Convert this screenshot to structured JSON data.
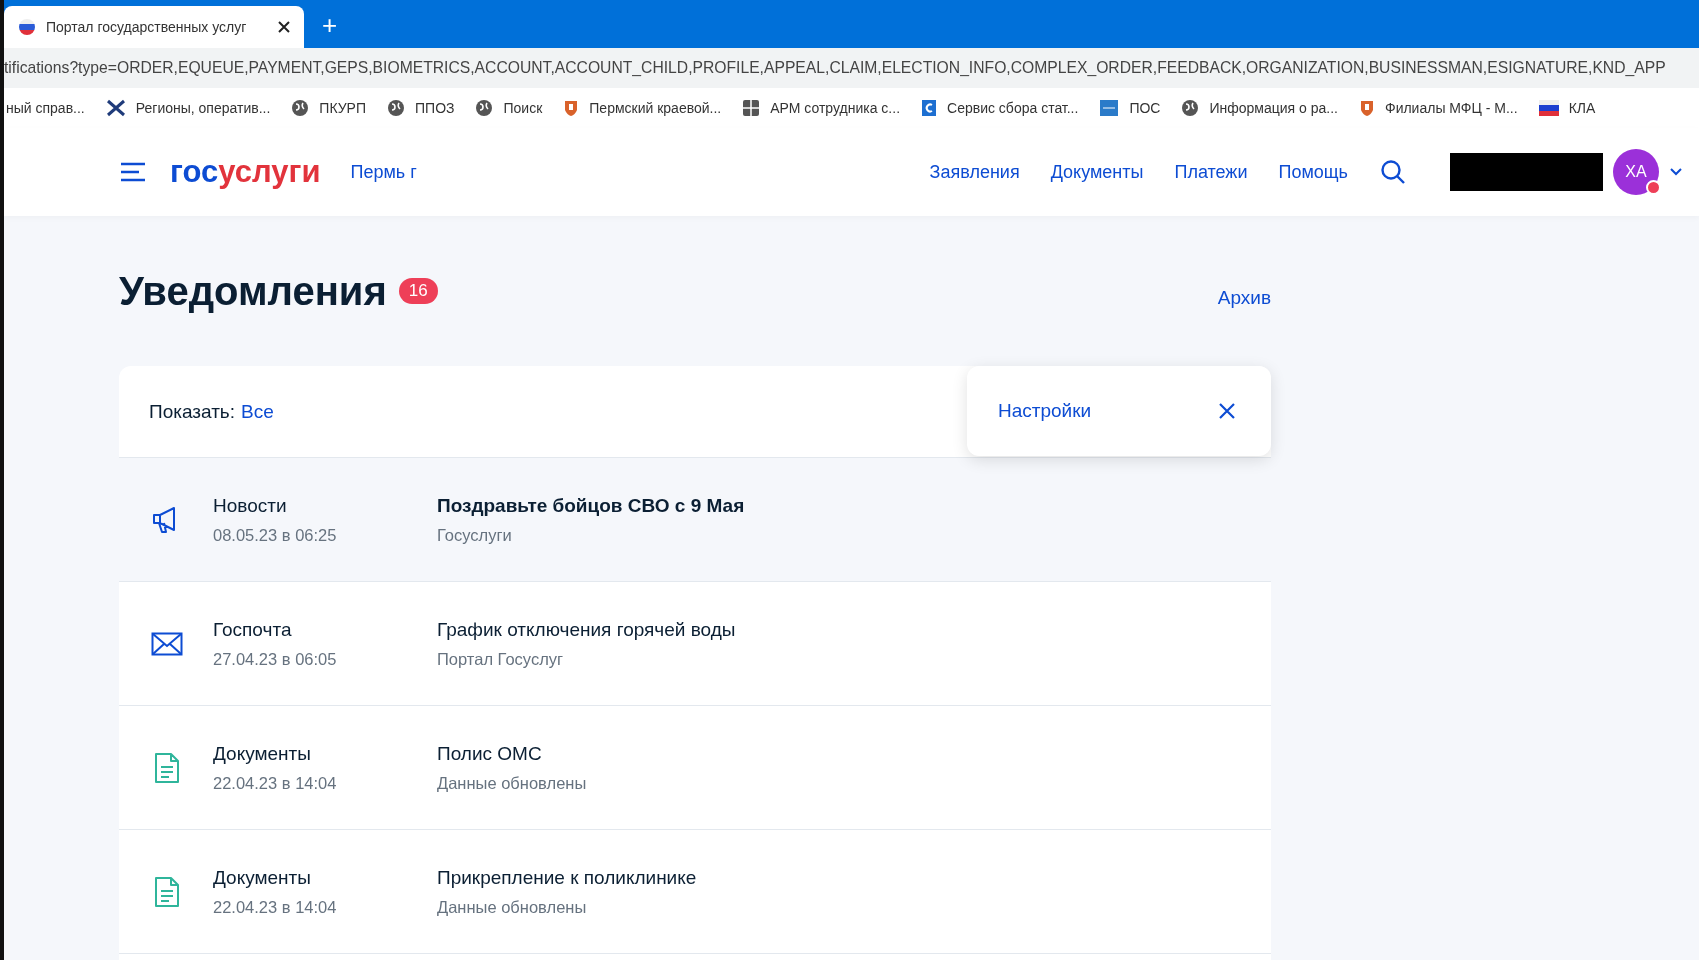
{
  "browser": {
    "tab": {
      "title": "Портал государственных услуг"
    },
    "new_tab": "+",
    "address": "tifications?type=ORDER,EQUEUE,PAYMENT,GEPS,BIOMETRICS,ACCOUNT,ACCOUNT_CHILD,PROFILE,APPEAL,CLAIM,ELECTION_INFO,COMPLEX_ORDER,FEEDBACK,ORGANIZATION,BUSINESSMAN,ESIGNATURE,KND_APP",
    "bookmarks": [
      {
        "label": "ный справ...",
        "kind": "none"
      },
      {
        "label": "Регионы, оператив...",
        "kind": "cross"
      },
      {
        "label": "ПКУРП",
        "kind": "globe"
      },
      {
        "label": "ППОЗ",
        "kind": "globe"
      },
      {
        "label": "Поиск",
        "kind": "globe"
      },
      {
        "label": "Пермский краевой...",
        "kind": "shield"
      },
      {
        "label": "АРМ сотрудника с...",
        "kind": "grid"
      },
      {
        "label": "Сервис сбора стат...",
        "kind": "letter"
      },
      {
        "label": "ПОС",
        "kind": "square"
      },
      {
        "label": "Информация о ра...",
        "kind": "globe"
      },
      {
        "label": "Филиалы МФЦ - М...",
        "kind": "shield"
      },
      {
        "label": "КЛА",
        "kind": "flag"
      }
    ]
  },
  "header": {
    "logo_a": "гос",
    "logo_b": "услуги",
    "region": "Пермь г",
    "nav": [
      "Заявления",
      "Документы",
      "Платежи",
      "Помощь"
    ],
    "avatar": "ХА",
    "avatar_alert": true
  },
  "page": {
    "title": "Уведомления",
    "count": "16",
    "archive": "Архив",
    "filter": {
      "label": "Показать:",
      "value": "Все"
    },
    "settings_popup": {
      "label": "Настройки"
    },
    "notifications": [
      {
        "kind": "news",
        "category": "Новости",
        "date": "08.05.23 в 06:25",
        "title": "Поздравьте бойцов СВО с 9 Мая",
        "subtitle": "Госуслуги",
        "unread": true
      },
      {
        "kind": "mail",
        "category": "Госпочта",
        "date": "27.04.23 в 06:05",
        "title": "График отключения горячей воды",
        "subtitle": "Портал Госуслуг",
        "unread": false
      },
      {
        "kind": "document",
        "category": "Документы",
        "date": "22.04.23 в 14:04",
        "title": "Полис ОМС",
        "subtitle": "Данные обновлены",
        "unread": false
      },
      {
        "kind": "document",
        "category": "Документы",
        "date": "22.04.23 в 14:04",
        "title": "Прикрепление к поликлинике",
        "subtitle": "Данные обновлены",
        "unread": false
      }
    ]
  }
}
